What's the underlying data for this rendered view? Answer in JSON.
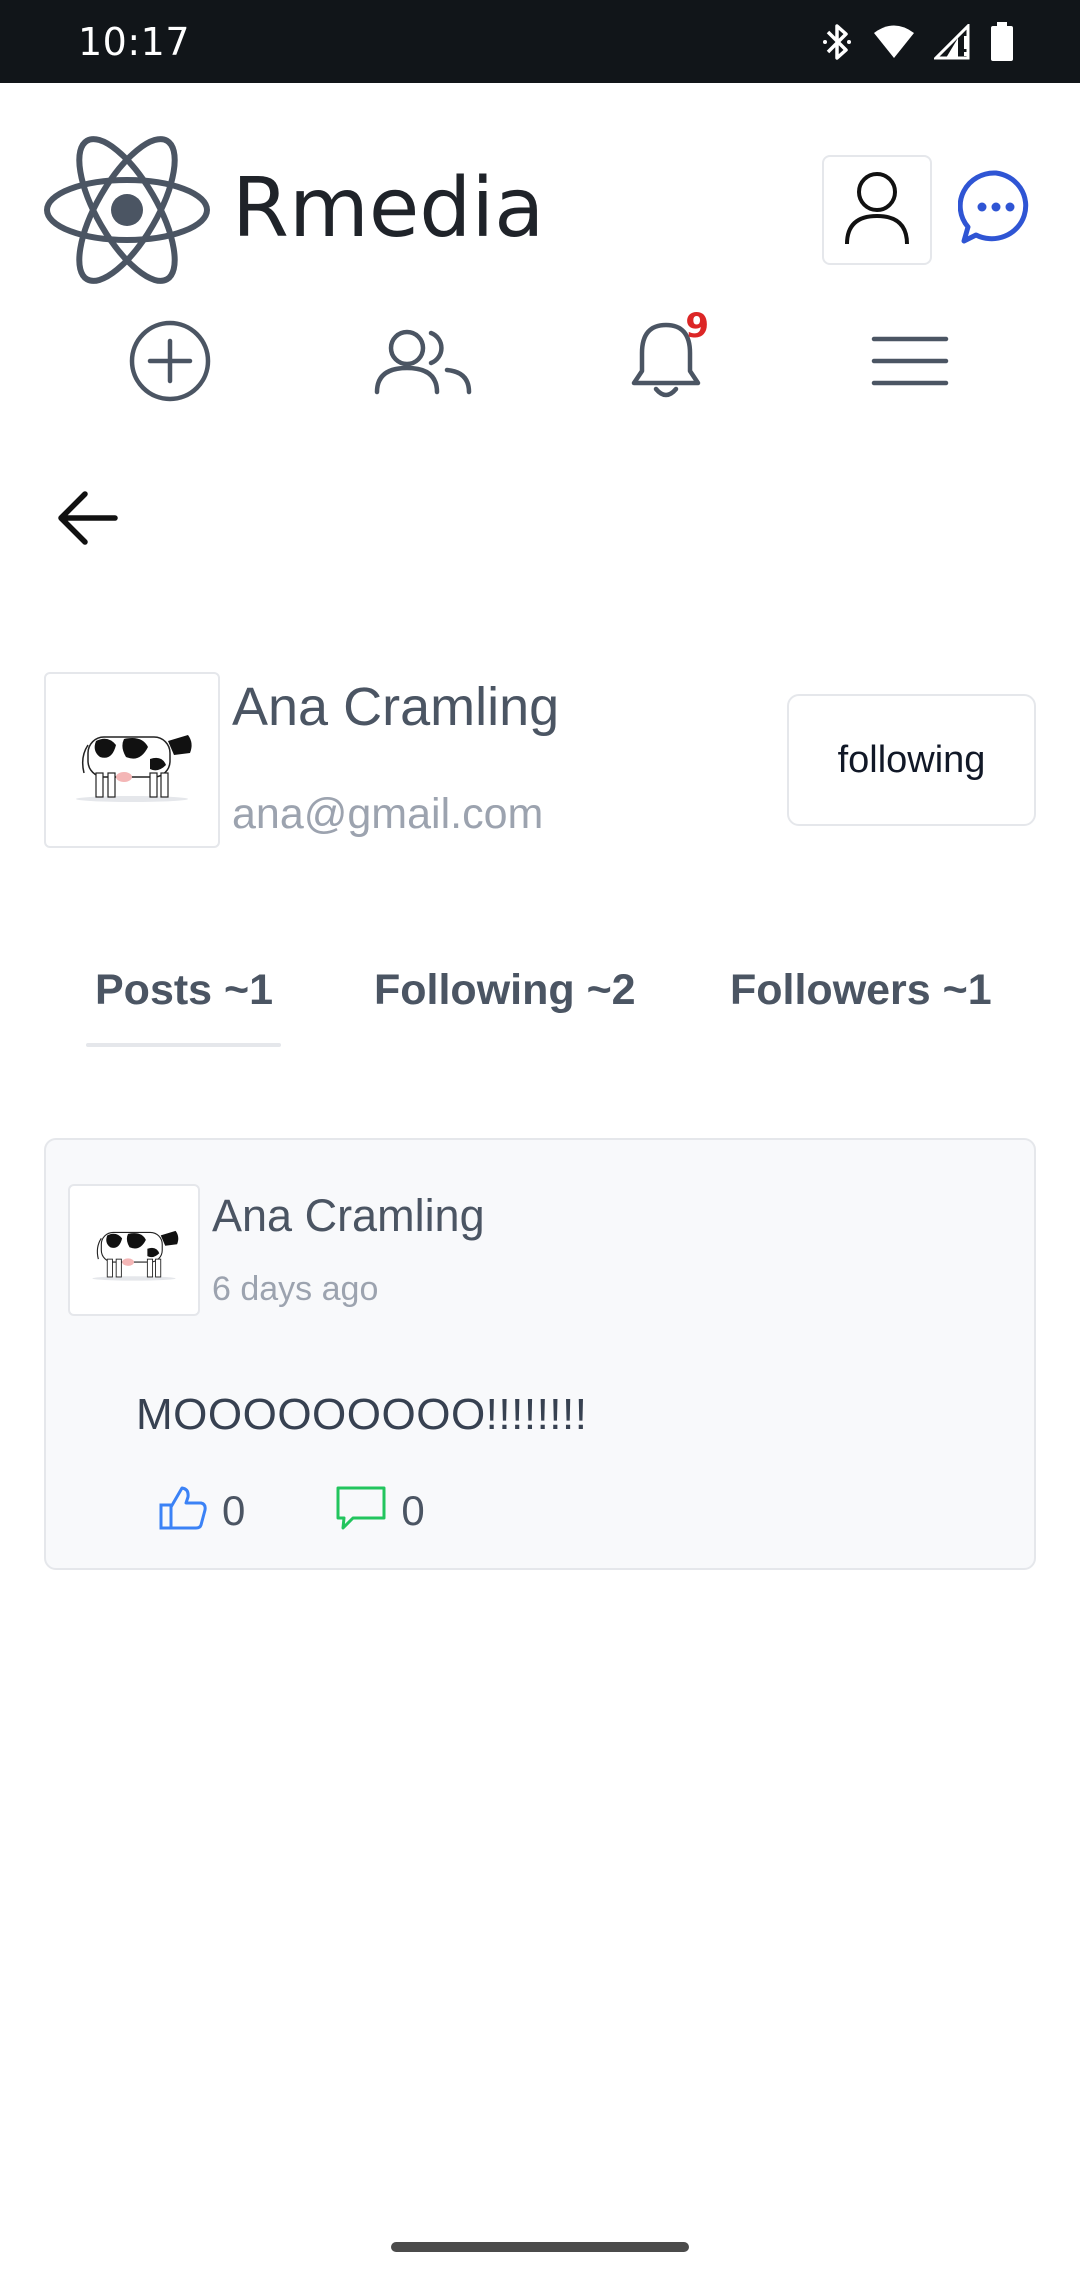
{
  "status_bar": {
    "time": "10:17",
    "icons": [
      "bluetooth-icon",
      "wifi-icon",
      "signal-icon",
      "battery-icon"
    ]
  },
  "header": {
    "brand": "Rmedia",
    "logo_icon": "react-atom-icon",
    "profile_icon": "user-icon",
    "chat_icon": "chat-bubble-icon",
    "accent_color": "#2f55d4"
  },
  "nav": {
    "items": [
      {
        "icon": "plus-circle-icon"
      },
      {
        "icon": "users-icon"
      },
      {
        "icon": "bell-icon",
        "badge": "9"
      },
      {
        "icon": "menu-icon"
      }
    ]
  },
  "profile": {
    "name": "Ana Cramling",
    "email": "ana@gmail.com",
    "follow_label": "following"
  },
  "tabs": [
    {
      "label": "Posts ~1",
      "active": true
    },
    {
      "label": "Following ~2",
      "active": false
    },
    {
      "label": "Followers ~1",
      "active": false
    }
  ],
  "post": {
    "author": "Ana Cramling",
    "time": "6 days ago",
    "body": "MOOOOOOOOO!!!!!!!!",
    "likes": "0",
    "comments": "0",
    "like_color": "#3b82f6",
    "comment_color": "#22c55e"
  }
}
